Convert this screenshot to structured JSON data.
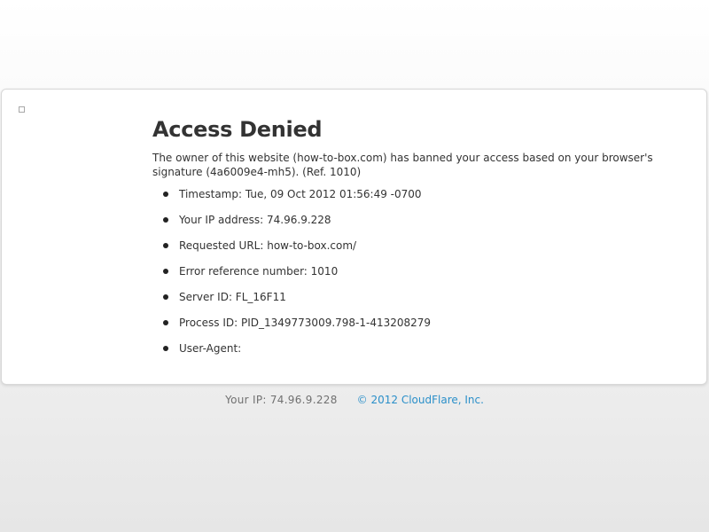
{
  "page": {
    "title": "Access Denied",
    "message": "The owner of this website (how-to-box.com) has banned your access based on your browser's signature (4a6009e4-mh5). (Ref. 1010)",
    "details": [
      "Timestamp: Tue, 09 Oct 2012 01:56:49 -0700",
      "Your IP address: 74.96.9.228",
      "Requested URL: how-to-box.com/",
      "Error reference number: 1010",
      "Server ID: FL_16F11",
      "Process ID: PID_1349773009.798-1-413208279",
      "User-Agent:"
    ]
  },
  "footer": {
    "ip_text": "Your IP: 74.96.9.228",
    "copyright_link": "© 2012 CloudFlare, Inc."
  },
  "colors": {
    "link": "#2a8fc9",
    "text": "#333333"
  },
  "icons": {
    "broken_image": "broken-image-icon"
  }
}
